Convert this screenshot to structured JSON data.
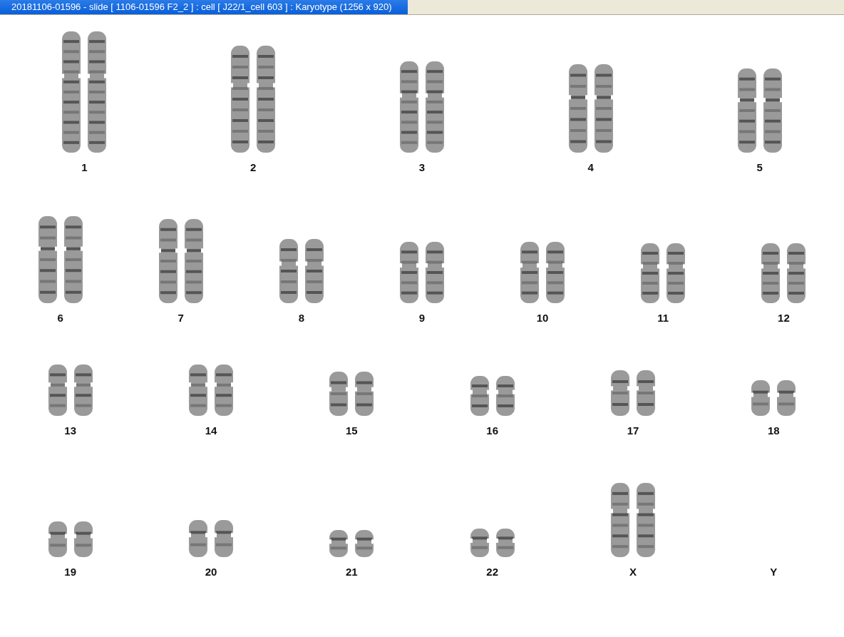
{
  "window": {
    "title": "20181106-01596 - slide [ 1106-01596 F2_2 ] : cell [ J22/1_cell 603 ] : Karyotype  (1256 x 920)"
  },
  "karyotype": {
    "rows": [
      {
        "pairs": [
          {
            "label": "1",
            "kind": "pair"
          },
          {
            "label": "2",
            "kind": "pair"
          },
          {
            "label": "3",
            "kind": "pair"
          },
          {
            "label": "4",
            "kind": "pair"
          },
          {
            "label": "5",
            "kind": "pair"
          }
        ]
      },
      {
        "pairs": [
          {
            "label": "6",
            "kind": "pair"
          },
          {
            "label": "7",
            "kind": "pair"
          },
          {
            "label": "8",
            "kind": "pair"
          },
          {
            "label": "9",
            "kind": "pair"
          },
          {
            "label": "10",
            "kind": "pair"
          },
          {
            "label": "11",
            "kind": "pair"
          },
          {
            "label": "12",
            "kind": "pair"
          }
        ]
      },
      {
        "pairs": [
          {
            "label": "13",
            "kind": "pair"
          },
          {
            "label": "14",
            "kind": "pair"
          },
          {
            "label": "15",
            "kind": "pair"
          },
          {
            "label": "16",
            "kind": "pair"
          },
          {
            "label": "17",
            "kind": "pair"
          },
          {
            "label": "18",
            "kind": "pair"
          }
        ]
      },
      {
        "pairs": [
          {
            "label": "19",
            "kind": "pair"
          },
          {
            "label": "20",
            "kind": "pair"
          },
          {
            "label": "21",
            "kind": "pair"
          },
          {
            "label": "22",
            "kind": "pair"
          },
          {
            "label": "X",
            "kind": "pair"
          },
          {
            "label": "Y",
            "kind": "empty"
          }
        ]
      }
    ]
  }
}
